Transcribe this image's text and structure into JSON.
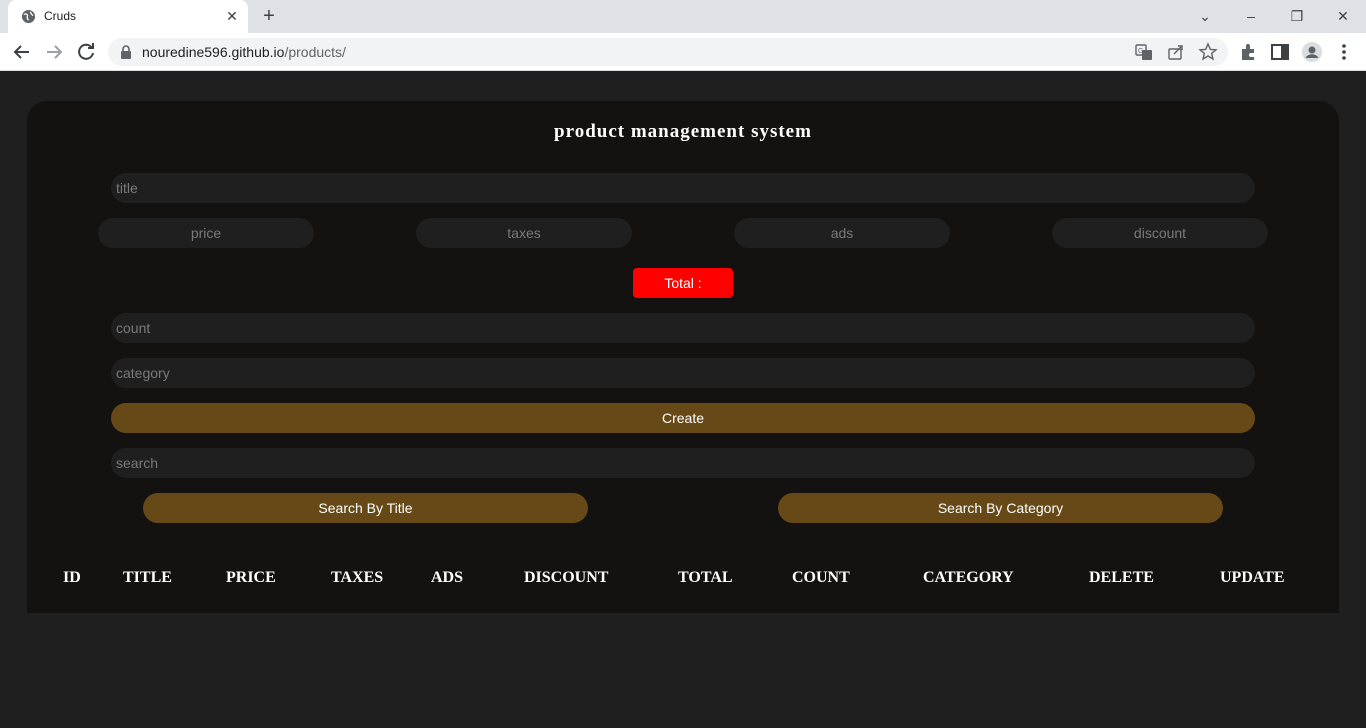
{
  "browser": {
    "tab_title": "Cruds",
    "url_host": "nouredine596.github.io",
    "url_path": "/products/"
  },
  "app": {
    "heading": "product management system",
    "inputs": {
      "title_placeholder": "title",
      "price_placeholder": "price",
      "taxes_placeholder": "taxes",
      "ads_placeholder": "ads",
      "discount_placeholder": "discount",
      "count_placeholder": "count",
      "category_placeholder": "category",
      "search_placeholder": "search"
    },
    "total_label": "Total :",
    "create_label": "Create",
    "search_by_title_label": "Search By Title",
    "search_by_category_label": "Search By Category",
    "table_headers": [
      "ID",
      "TITLE",
      "PRICE",
      "TAXES",
      "ADS",
      "DISCOUNT",
      "TOTAL",
      "COUNT",
      "CATEGORY",
      "DELETE",
      "UPDATE"
    ]
  },
  "colors": {
    "panel_bg": "#131210",
    "input_bg": "#1f1f1f",
    "accent_brown": "#674918",
    "total_red": "#ff0000"
  }
}
